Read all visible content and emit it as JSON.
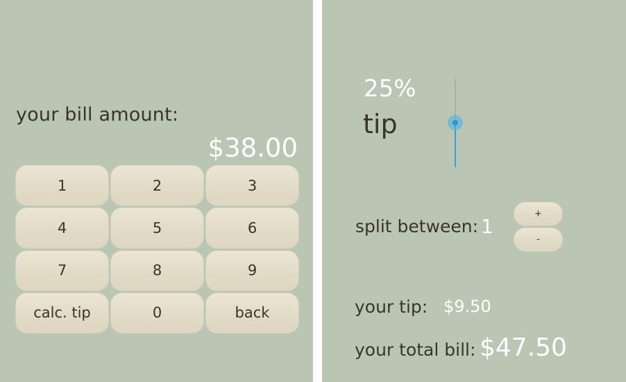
{
  "colors": {
    "background": "#bac6b4",
    "dark_text": "#3b332a",
    "light_text": "#ffffff",
    "button": "#e2dcc8",
    "slider_accent": "#3a9ed9"
  },
  "left": {
    "bill_label": "your bill amount:",
    "bill_amount": "$38.00",
    "keys": [
      "1",
      "2",
      "3",
      "4",
      "5",
      "6",
      "7",
      "8",
      "9",
      "calc. tip",
      "0",
      "back"
    ]
  },
  "right": {
    "tip_percent": "25%",
    "tip_word": "tip",
    "tip_slider_level": 0.5,
    "split_label": "split between:",
    "split_count": "1",
    "plus_label": "+",
    "minus_label": "-",
    "tip_label": "your tip:",
    "tip_value": "$9.50",
    "total_label": "your total bill:",
    "total_value": "$47.50"
  }
}
